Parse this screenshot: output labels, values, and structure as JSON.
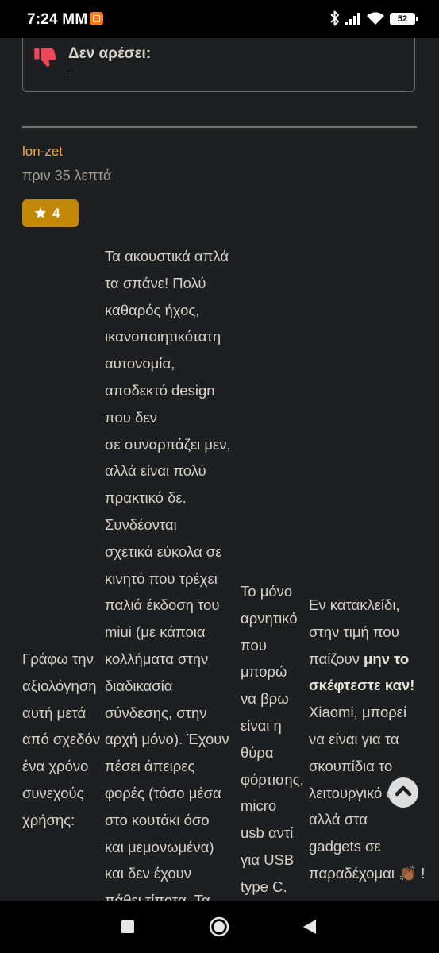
{
  "status_bar": {
    "time": "7:24 MM",
    "battery": "52",
    "icons": [
      "app-notification-icon",
      "bluetooth-icon",
      "cell-signal-icon",
      "wifi-icon",
      "battery-icon"
    ]
  },
  "previous_review": {
    "dislike_label": "Δεν αρέσει:",
    "dislike_value": "-"
  },
  "review": {
    "author": "lon-zet",
    "timestamp": "πριν 35 λεπτά",
    "rating": "4",
    "columns": [
      [
        "Γράφω την",
        "αξιολόγηση",
        "αυτή μετά",
        "από σχεδόν",
        "ένα χρόνο",
        "συνεχούς",
        "χρήσης:"
      ],
      [
        "Τα ακουστικά απλά",
        "τα σπάνε! Πολύ",
        "καθαρός ήχος,",
        "ικανοποιητικότατη",
        "αυτονομία,",
        "αποδεκτό design",
        "που δεν",
        "σε συναρπάζει μεν,",
        "αλλά είναι πολύ",
        "πρακτικό δε.",
        "Συνδέονται",
        "σχετικά εύκολα σε",
        "κινητό που τρέχει",
        "παλιά έκδοση του",
        "miui (με κάποια",
        "κολλήματα στην",
        "διαδικασία",
        "σύνδεσης, στην",
        "αρχή μόνο). Έχουν",
        "πέσει άπειρες",
        "φορές (τόσο μέσα",
        "στο κουτάκι όσο",
        "και μεμονωμένα)",
        "και δεν έχουν",
        "πάθει τίποτα. Τα"
      ],
      [
        "Το μόνο",
        "αρνητικό",
        "που",
        "μπορώ",
        "να βρω",
        "είναι η",
        "θύρα",
        "φόρτισης,",
        "micro",
        "usb αντί",
        "για USB",
        "type C."
      ],
      [
        "Εν κατακλείδι,",
        "στην τιμή που",
        "παίζουν",
        "μην το",
        "σκέφτεστε καν!",
        "Xiaomi, μπορεί",
        "να είναι για τα",
        "σκουπίδια το",
        "λειτουργικό σου,",
        "αλλά στα",
        "gadgets σε",
        "παραδέχομαι 👏🏾 !"
      ]
    ]
  },
  "colors": {
    "background": "#1e1f21",
    "author": "#f2a74a",
    "rating_badge": "#c38707",
    "dislike_icon": "#f0465a"
  }
}
